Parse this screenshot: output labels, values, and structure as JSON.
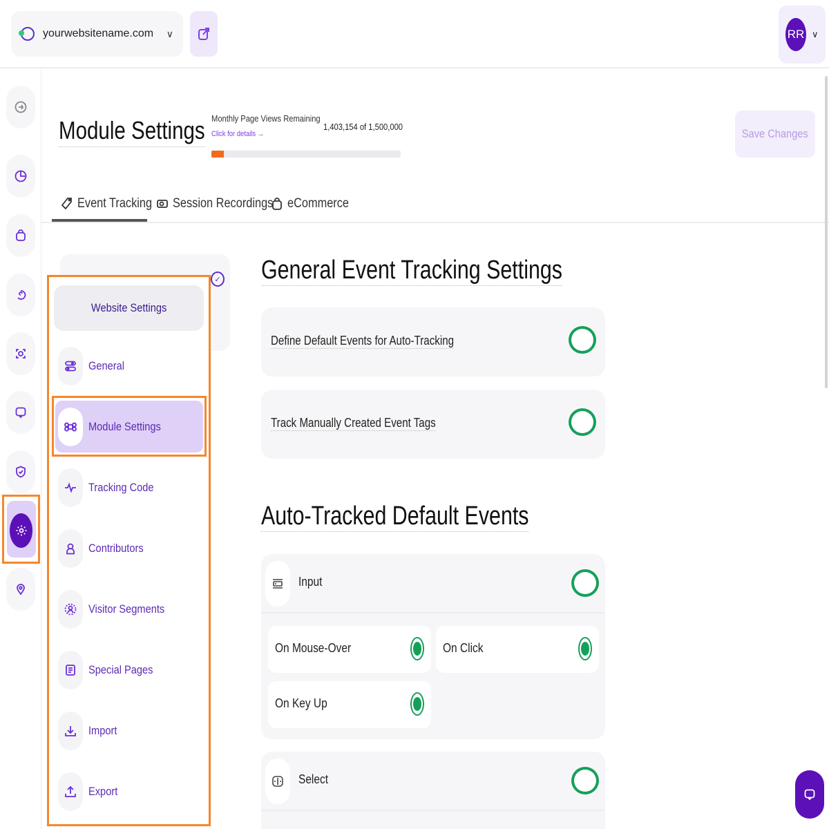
{
  "topbar": {
    "site_name": "yourwebsitename.com",
    "avatar_initials": "RR"
  },
  "header": {
    "title": "Module Settings",
    "page_views_label": "Monthly Page Views Remaining",
    "details_link": "Click for details →",
    "page_views_count": "1,403,154 of 1,500,000",
    "page_views_used_fraction": 0.064,
    "save_label": "Save Changes"
  },
  "tabs": [
    {
      "label": "Event Tracking",
      "icon": "tag-icon",
      "active": true
    },
    {
      "label": "Session Recordings",
      "icon": "camera-icon",
      "active": false
    },
    {
      "label": "eCommerce",
      "icon": "shopping-bag-icon",
      "active": false
    }
  ],
  "menu": {
    "website_settings_label": "Website Settings",
    "items": [
      {
        "label": "General",
        "icon": "toggles-icon"
      },
      {
        "label": "Module Settings",
        "icon": "command-icon",
        "active": true
      },
      {
        "label": "Tracking Code",
        "icon": "pulse-icon"
      },
      {
        "label": "Contributors",
        "icon": "user-icon"
      },
      {
        "label": "Visitor Segments",
        "icon": "segment-icon"
      },
      {
        "label": "Special Pages",
        "icon": "pages-icon"
      },
      {
        "label": "Import",
        "icon": "download-icon"
      },
      {
        "label": "Export",
        "icon": "upload-icon"
      }
    ]
  },
  "content": {
    "general_heading": "General Event Tracking Settings",
    "settings": [
      {
        "label": "Define Default Events for Auto-Tracking",
        "enabled": true
      },
      {
        "label": "Track Manually Created Event Tags",
        "enabled": true
      }
    ],
    "auto_heading": "Auto-Tracked Default Events",
    "groups": [
      {
        "title": "Input",
        "icon": "input-icon",
        "enabled": true,
        "options": [
          {
            "label": "On Mouse-Over",
            "selected": true
          },
          {
            "label": "On Click",
            "selected": true
          },
          {
            "label": "On Key Up",
            "selected": true
          }
        ]
      },
      {
        "title": "Select",
        "icon": "select-icon",
        "enabled": true,
        "options": []
      }
    ]
  },
  "colors": {
    "accent": "#5b10b8",
    "toggle_on": "#15a05a",
    "highlight": "#f5862b",
    "progress": "#f26b1d"
  }
}
